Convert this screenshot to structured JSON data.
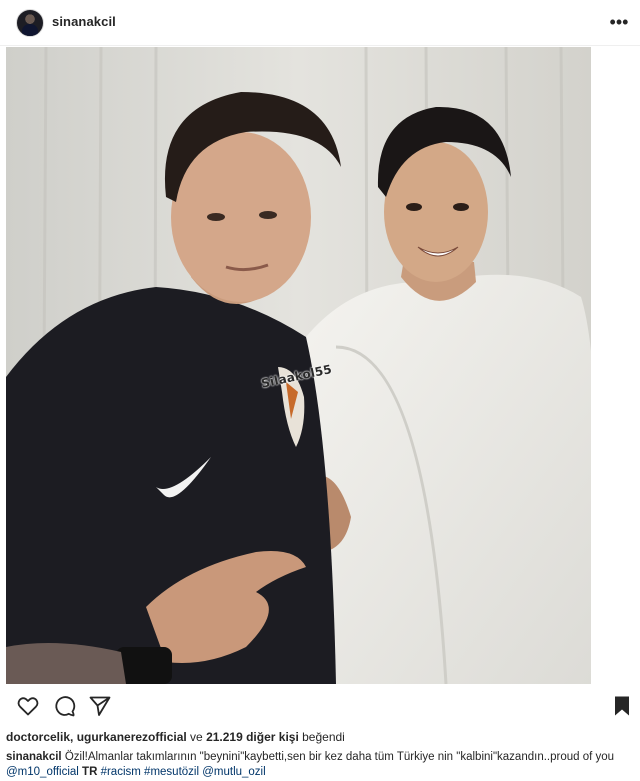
{
  "post": {
    "username": "sinanakcil",
    "more_icon": "more-options-icon",
    "photo": {
      "watermark": "Silaakol55"
    },
    "actions": {
      "icons": [
        "heart-icon",
        "comment-icon",
        "share-icon",
        "bookmark-icon"
      ]
    },
    "likes": {
      "users": "doctorcelik, ugurkanerezofficial",
      "connector": " ve ",
      "count": "21.219 diğer kişi",
      "suffix": " beğendi"
    },
    "caption": {
      "author": "sinanakcil",
      "text": " Özil!Almanlar takımlarının \"beynini\"kaybetti,sen bir kez daha tüm Türkiye nin \"kalbini\"kazandın..proud of you",
      "mention_1": "@m10_official",
      "flag": " TR ",
      "hashtag_1": "#racism",
      "hashtag_2": "#mesutözil",
      "mention_2": "@mutlu_ozil"
    }
  },
  "colors": {
    "text": "#262626",
    "link": "#003569",
    "border": "#efefef"
  }
}
